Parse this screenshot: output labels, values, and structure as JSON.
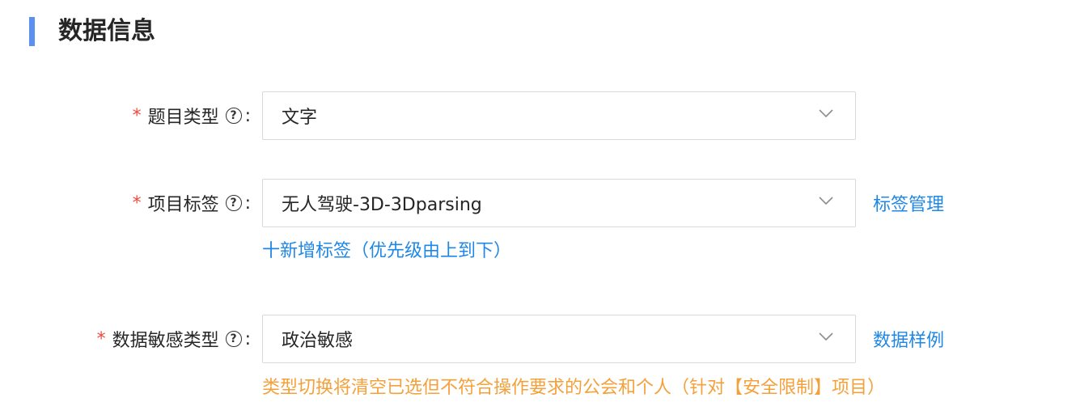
{
  "section": {
    "title": "数据信息"
  },
  "fields": [
    {
      "label": "题目类型",
      "required_mark": "*",
      "colon": ":",
      "value": "文字"
    },
    {
      "label": "项目标签",
      "required_mark": "*",
      "colon": ":",
      "value": "无人驾驶-3D-3Dparsing",
      "link": "标签管理",
      "add_link": "十新增标签（优先级由上到下）"
    },
    {
      "label": "数据敏感类型",
      "required_mark": "*",
      "colon": ":",
      "value": "政治敏感",
      "link": "数据样例",
      "warning": "类型切换将清空已选但不符合操作要求的公会和个人（针对【安全限制】项目）"
    }
  ],
  "icons": {
    "help": "question-circle-icon",
    "dropdown": "chevron-down-icon"
  },
  "colors": {
    "accent_bar": "#5b8ff0",
    "link": "#1f87e5",
    "required": "#f0483e",
    "warning": "#f4a13b"
  }
}
